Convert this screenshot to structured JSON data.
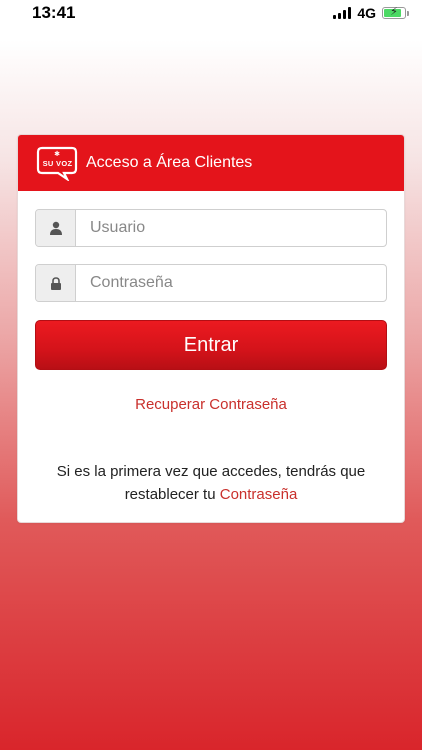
{
  "status_bar": {
    "time": "13:41",
    "network": "4G",
    "battery_level": 0.85
  },
  "login": {
    "logo_text": "SU VOZ",
    "title": "Acceso a Área Clientes",
    "username_placeholder": "Usuario",
    "password_placeholder": "Contraseña",
    "submit_label": "Entrar",
    "recover_label": "Recuperar Contraseña",
    "info_text": "Si es la primera vez que accedes, tendrás que restablecer tu",
    "info_link": "Contraseña"
  },
  "colors": {
    "brand_red": "#e4141b",
    "link_red": "#c9302c"
  },
  "icons": {
    "username": "user-icon",
    "password": "lock-icon",
    "brand": "suvoz-logo"
  }
}
